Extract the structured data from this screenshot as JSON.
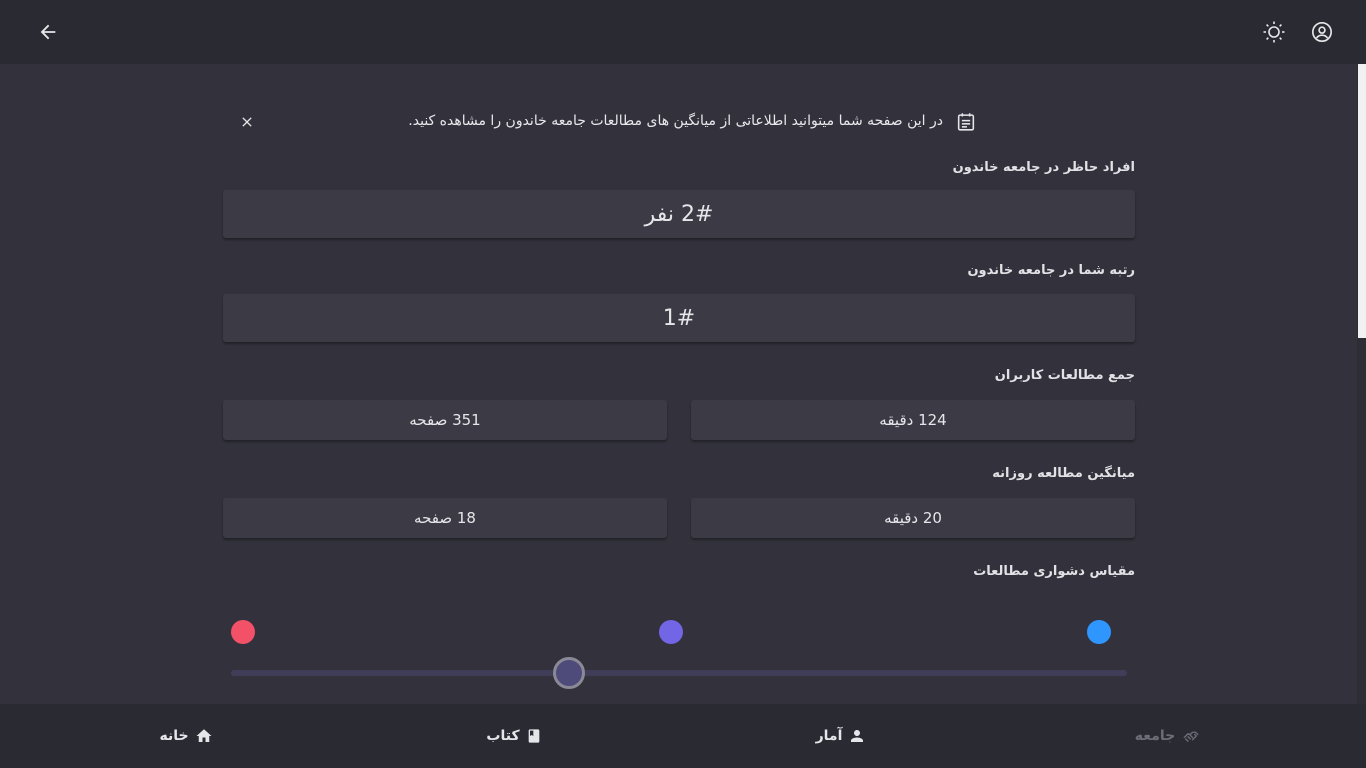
{
  "header": {
    "back_icon": "arrow-left-icon",
    "theme_icon": "sun-icon",
    "account_icon": "account-circle-icon"
  },
  "notice": {
    "text": "در این صفحه شما میتوانید اطلاعاتی از میانگین های مطالعات جامعه خاندون را مشاهده کنید.",
    "icon": "calendar-note-icon",
    "close_icon": "close-icon"
  },
  "members": {
    "title": "افراد حاظر در جامعه خاندون",
    "value": "2# نفر"
  },
  "rank": {
    "title": "رتبه شما در جامعه خاندون",
    "value": "1#"
  },
  "total_reading": {
    "title": "جمع مطالعات کاربران",
    "minutes": "124 دقیقه",
    "pages": "351 صفحه"
  },
  "daily_average": {
    "title": "میانگین مطالعه روزانه",
    "minutes": "20 دقیقه",
    "pages": "18 صفحه"
  },
  "difficulty": {
    "title": "مقیاس دشواری مطالعات",
    "colors": {
      "easy": "#2f95ff",
      "medium": "#7366e6",
      "hard": "#f25168"
    }
  },
  "bottom_nav": {
    "items": [
      {
        "label": "خانه",
        "icon": "home-icon"
      },
      {
        "label": "کتاب",
        "icon": "book-icon"
      },
      {
        "label": "آمار",
        "icon": "person-icon"
      },
      {
        "label": "جامعه",
        "icon": "handshake-icon"
      }
    ]
  }
}
